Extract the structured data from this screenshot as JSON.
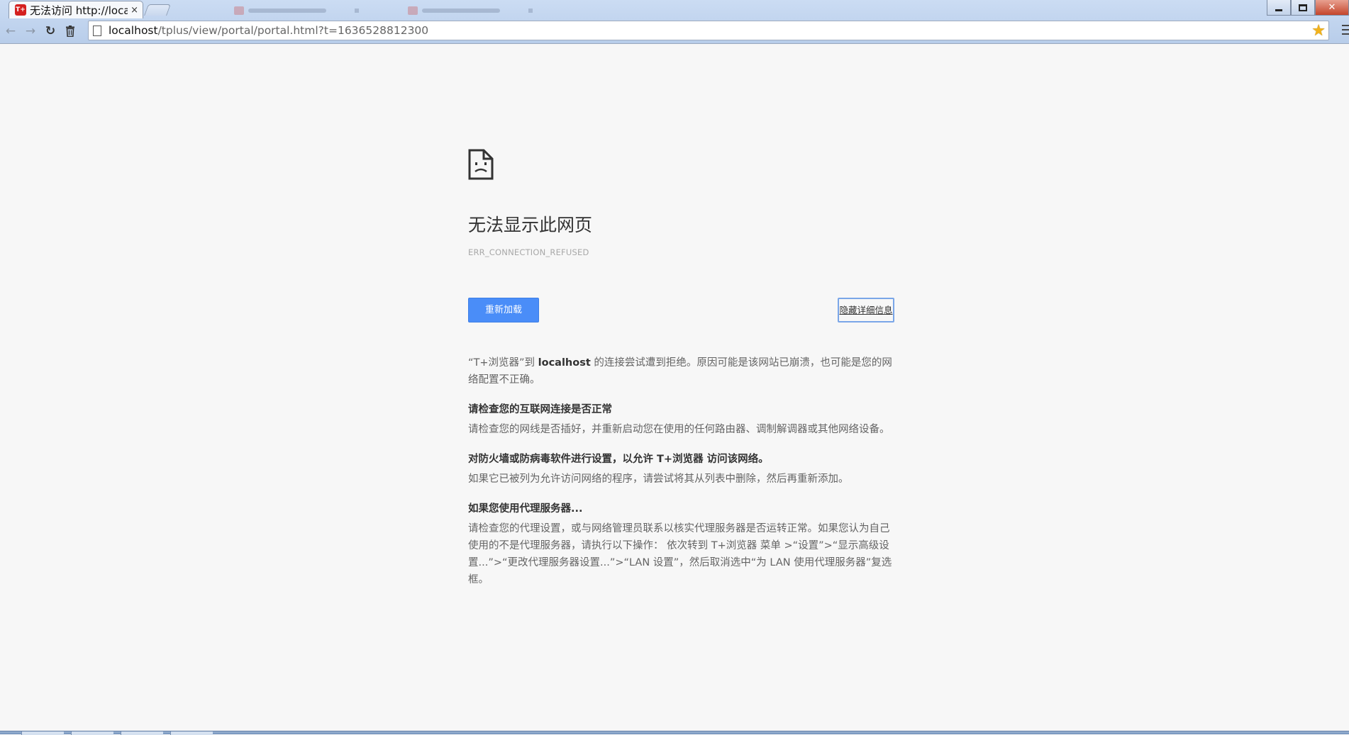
{
  "browser": {
    "tab_favicon_text": "T+",
    "tab_title": "无法访问 http://local",
    "tab_close": "×",
    "address_host": "localhost",
    "address_path": "/tplus/view/portal/portal.html?t=1636528812300",
    "back_glyph": "←",
    "forward_glyph": "→",
    "reload_glyph": "↻",
    "trash_glyph": "🗑",
    "star_glyph": "★",
    "close_glyph": "✕"
  },
  "error_page": {
    "icon": "sad-page-icon",
    "heading": "无法显示此网页",
    "error_code": "ERR_CONNECTION_REFUSED",
    "reload_button": "重新加载",
    "details_button": "隐藏详细信息",
    "summary_prefix": "“T+浏览器”到 ",
    "summary_host": "localhost",
    "summary_suffix": " 的连接尝试遭到拒绝。原因可能是该网站已崩溃，也可能是您的网络配置不正确。",
    "sections": [
      {
        "title": "请检查您的互联网连接是否正常",
        "body": "请检查您的网线是否插好，并重新启动您在使用的任何路由器、调制解调器或其他网络设备。"
      },
      {
        "title": "对防火墙或防病毒软件进行设置，以允许 T+浏览器 访问该网络。",
        "body": "如果它已被列为允许访问网络的程序，请尝试将其从列表中删除，然后再重新添加。"
      },
      {
        "title": "如果您使用代理服务器...",
        "body": "请检查您的代理设置，或与网络管理员联系以核实代理服务器是否运转正常。如果您认为自己使用的不是代理服务器，请执行以下操作： 依次转到 T+浏览器 菜单 >“设置”>“显示高级设置...”>“更改代理服务器设置...”>“LAN 设置”，然后取消选中“为 LAN 使用代理服务器”复选框。"
      }
    ]
  },
  "colors": {
    "page_bg": "#f7f7f7",
    "button_blue": "#4a8df8",
    "heading": "#333333",
    "body_text": "#646464",
    "error_code": "#a8a8a8"
  }
}
